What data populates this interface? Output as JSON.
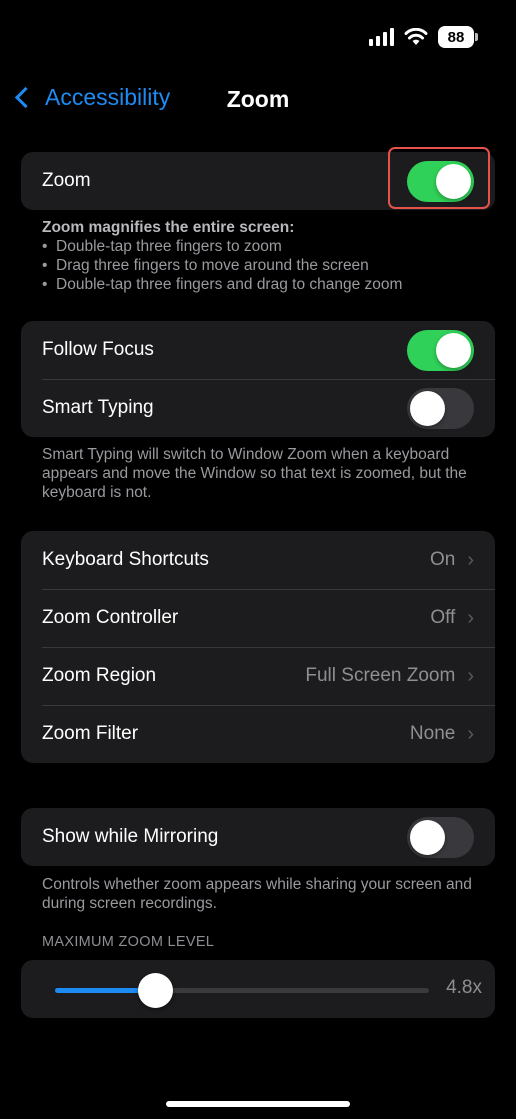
{
  "status": {
    "battery": "88",
    "battery_icon": "battery-icon",
    "wifi_icon": "wifi-icon",
    "signal_icon": "cellular-signal-icon"
  },
  "nav": {
    "back_label": "Accessibility",
    "title": "Zoom"
  },
  "zoom_toggle": {
    "label": "Zoom",
    "on": true
  },
  "zoom_note": {
    "heading": "Zoom magnifies the entire screen:",
    "bullets": [
      "Double-tap three fingers to zoom",
      "Drag three fingers to move around the screen",
      "Double-tap three fingers and drag to change zoom"
    ]
  },
  "focus_group": {
    "follow_focus": {
      "label": "Follow Focus",
      "on": true
    },
    "smart_typing": {
      "label": "Smart Typing",
      "on": false
    }
  },
  "smart_typing_note": "Smart Typing will switch to Window Zoom when a keyboard appears and move the Window so that text is zoomed, but the keyboard is not.",
  "settings_group": {
    "items": [
      {
        "label": "Keyboard Shortcuts",
        "value": "On"
      },
      {
        "label": "Zoom Controller",
        "value": "Off"
      },
      {
        "label": "Zoom Region",
        "value": "Full Screen Zoom"
      },
      {
        "label": "Zoom Filter",
        "value": "None"
      }
    ]
  },
  "mirroring": {
    "label": "Show while Mirroring",
    "on": false
  },
  "mirroring_note": "Controls whether zoom appears while sharing your screen and during screen recordings.",
  "max_zoom": {
    "header": "MAXIMUM ZOOM LEVEL",
    "value_label": "4.8x",
    "fraction": 0.27
  },
  "colors": {
    "accent": "#1d8bf2",
    "toggle_on": "#30d158",
    "highlight": "#e5534b",
    "cell_background": "#1c1c1e"
  }
}
